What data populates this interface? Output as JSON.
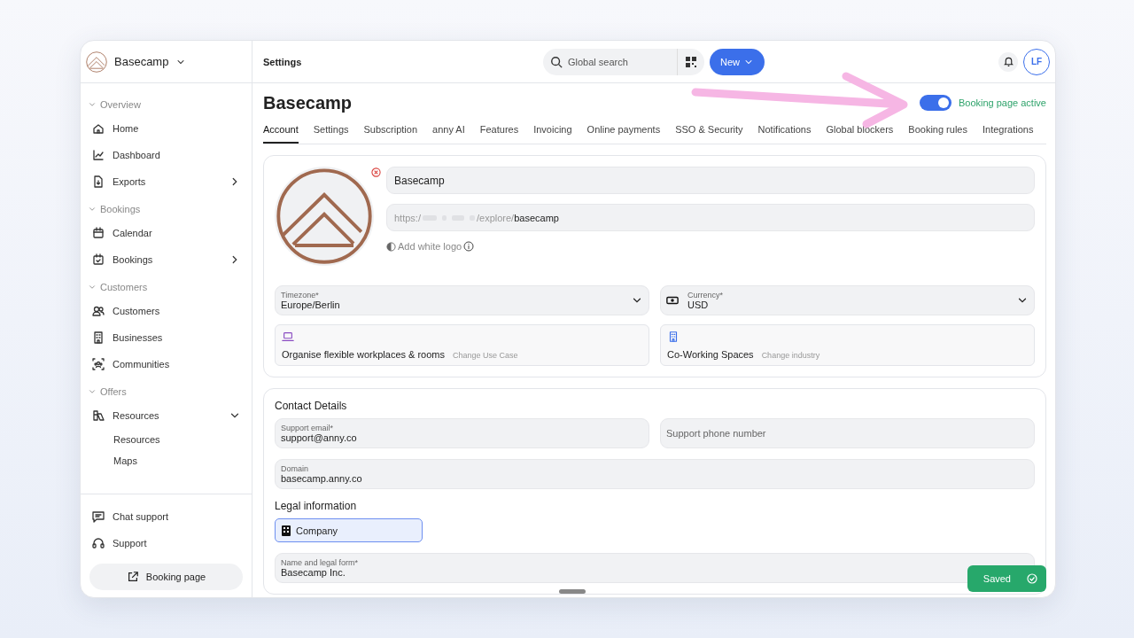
{
  "sidebar": {
    "workspace": "Basecamp",
    "sections": [
      {
        "title": "Overview",
        "expanded": true,
        "items": [
          {
            "label": "Home",
            "kind": "home"
          },
          {
            "label": "Dashboard",
            "kind": "chart"
          },
          {
            "label": "Exports",
            "kind": "file",
            "expanded": false
          }
        ]
      },
      {
        "title": "Bookings",
        "expanded": true,
        "items": [
          {
            "label": "Calendar",
            "kind": "calendar"
          },
          {
            "label": "Bookings",
            "kind": "calendar-check",
            "expanded": false
          }
        ]
      },
      {
        "title": "Customers",
        "expanded": true,
        "items": [
          {
            "label": "Customers",
            "kind": "users"
          },
          {
            "label": "Businesses",
            "kind": "building"
          },
          {
            "label": "Communities",
            "kind": "group"
          }
        ]
      },
      {
        "title": "Offers",
        "expanded": true,
        "items": [
          {
            "label": "Resources",
            "kind": "resources",
            "expanded": true,
            "children": [
              {
                "label": "Resources"
              },
              {
                "label": "Maps"
              }
            ]
          }
        ]
      }
    ],
    "footer": [
      {
        "label": "Chat support",
        "kind": "chat"
      },
      {
        "label": "Support",
        "kind": "headset"
      }
    ],
    "booking_page_button": "Booking page"
  },
  "topbar": {
    "title": "Settings",
    "search": {
      "placeholder": "Global search"
    },
    "new_button": "New",
    "avatar": "LF"
  },
  "page": {
    "title": "Basecamp",
    "booking_toggle": {
      "label": "Booking page active",
      "on": true
    },
    "tabs": [
      {
        "label": "Account",
        "selected": true
      },
      {
        "label": "Settings",
        "selected": false
      },
      {
        "label": "Subscription",
        "selected": false
      },
      {
        "label": "anny AI",
        "selected": false
      },
      {
        "label": "Features",
        "selected": false
      },
      {
        "label": "Invoicing",
        "selected": false
      },
      {
        "label": "Online payments",
        "selected": false
      },
      {
        "label": "SSO & Security",
        "selected": false
      },
      {
        "label": "Notifications",
        "selected": false
      },
      {
        "label": "Global blockers",
        "selected": false
      },
      {
        "label": "Booking rules",
        "selected": false
      },
      {
        "label": "Integrations",
        "selected": false
      }
    ]
  },
  "profile": {
    "name": "Basecamp",
    "url": {
      "prefix": "https:/",
      "path": "/explore/",
      "slug": "basecamp"
    },
    "white_logo_link": "Add white logo",
    "timezone": {
      "label": "Timezone*",
      "value": "Europe/Berlin"
    },
    "currency": {
      "label": "Currency*",
      "value": "USD"
    },
    "use_case": {
      "title": "Organise flexible workplaces & rooms",
      "action": "Change Use Case"
    },
    "industry": {
      "title": "Co-Working Spaces",
      "action": "Change industry"
    }
  },
  "contact": {
    "heading": "Contact Details",
    "support_email": {
      "label": "Support email*",
      "value": "support@anny.co"
    },
    "support_phone": {
      "placeholder": "Support phone number"
    },
    "domain": {
      "label": "Domain",
      "value": "basecamp.anny.co"
    }
  },
  "legal": {
    "heading": "Legal information",
    "entity_type": {
      "label": "Company",
      "selected": true
    },
    "name": {
      "label": "Name and legal form*",
      "value": "Basecamp Inc."
    }
  },
  "toast": "Saved"
}
